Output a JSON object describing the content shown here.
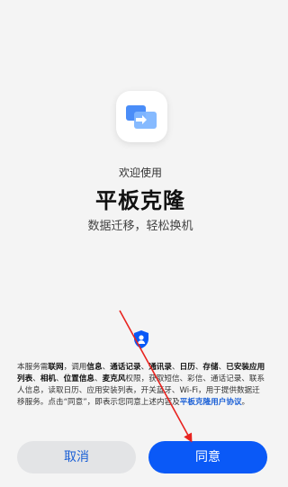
{
  "app": {
    "icon": "tablet-clone-icon",
    "welcome": "欢迎使用",
    "title": "平板克隆",
    "subtitle": "数据迁移，轻松换机"
  },
  "privacy": {
    "icon": "privacy-shield-icon",
    "segments": [
      {
        "text": "本服务需",
        "bold": false
      },
      {
        "text": "联网",
        "bold": true
      },
      {
        "text": "，调用",
        "bold": false
      },
      {
        "text": "信息",
        "bold": true
      },
      {
        "text": "、",
        "bold": false
      },
      {
        "text": "通话记录",
        "bold": true
      },
      {
        "text": "、",
        "bold": false
      },
      {
        "text": "通讯录",
        "bold": true
      },
      {
        "text": "、",
        "bold": false
      },
      {
        "text": "日历",
        "bold": true
      },
      {
        "text": "、",
        "bold": false
      },
      {
        "text": "存储",
        "bold": true
      },
      {
        "text": "、",
        "bold": false
      },
      {
        "text": "已安装应用列表",
        "bold": true
      },
      {
        "text": "、",
        "bold": false
      },
      {
        "text": "相机",
        "bold": true
      },
      {
        "text": "、",
        "bold": false
      },
      {
        "text": "位置信息",
        "bold": true
      },
      {
        "text": "、",
        "bold": false
      },
      {
        "text": "麦克风",
        "bold": true
      },
      {
        "text": "权限，获取短信、彩信、通话记录、联系人信息，读取日历、应用安装列表，开关蓝牙、Wi-Fi，用于提供数据迁移服务。点击“同意”，即表示您同意上述内容及",
        "bold": false
      }
    ],
    "link_text": "平板克隆用户协议",
    "tail": "。"
  },
  "buttons": {
    "cancel": "取消",
    "agree": "同意"
  },
  "colors": {
    "accent": "#0a59f7",
    "link": "#1a5fd6",
    "annotation_arrow": "#e8231f"
  }
}
